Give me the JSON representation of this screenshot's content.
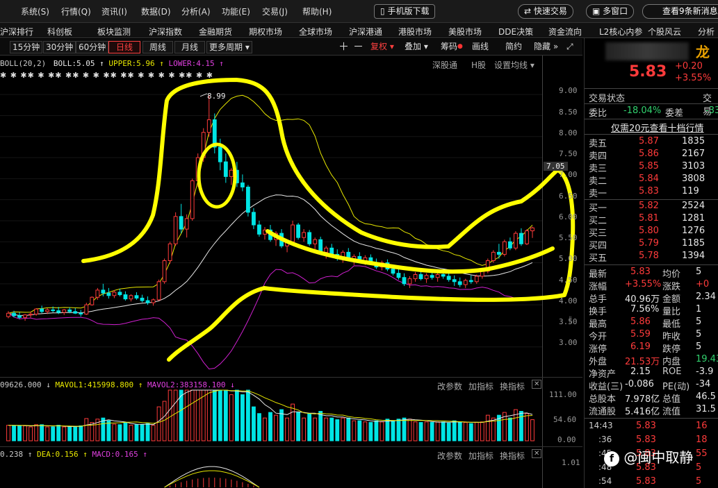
{
  "menu": {
    "items": [
      "系统(S)",
      "行情(Q)",
      "资讯(I)",
      "数据(D)",
      "分析(A)",
      "功能(E)",
      "交易(J)",
      "帮助(H)"
    ],
    "mobile_download": "手机版下载",
    "quick_trade": "快速交易",
    "multi_window": "多窗口",
    "notifications": "查看9条新消息"
  },
  "nav": {
    "items": [
      "沪深排行",
      "科创板",
      "板块监测",
      "沪深指数",
      "金融期货",
      "期权市场",
      "全球市场",
      "沪深港通",
      "港股市场",
      "美股市场",
      "DDE决策",
      "资金流向",
      "L2核心内参",
      "个股风云",
      "分析"
    ]
  },
  "period": {
    "items": [
      "15分钟",
      "30分钟",
      "60分钟",
      "日线",
      "周线",
      "月线",
      "更多周期"
    ],
    "active": "日线",
    "tools": [
      "复权",
      "叠加",
      "筹码",
      "画线",
      "简约",
      "隐藏"
    ]
  },
  "main_chart": {
    "boll_label": "BOLL(20,2)",
    "boll_value": "BOLL:5.05",
    "upper": "UPPER:5.96",
    "lower": "LOWER:4.15",
    "links": [
      "深股通",
      "H股",
      "设置均线"
    ],
    "peak_label": "8.99",
    "current_marker": "7.05",
    "y_ticks": [
      "9.00",
      "8.50",
      "8.00",
      "7.50",
      "7.00",
      "6.50",
      "6.00",
      "5.50",
      "5.00",
      "4.50",
      "4.00",
      "3.50",
      "3.00"
    ]
  },
  "vol_panel": {
    "vol": "09626.000",
    "mavol1": "MAVOL1:415998.800",
    "mavol2": "MAVOL2:383158.100",
    "buttons": [
      "改参数",
      "加指标",
      "换指标"
    ],
    "y_ticks": [
      "111.00",
      "54.60",
      "0.00"
    ]
  },
  "macd_panel": {
    "dif": "0.238",
    "dea": "DEA:0.156",
    "macd": "MACD:0.165",
    "buttons": [
      "改参数",
      "加指标",
      "换指标"
    ],
    "y_ticks": [
      "1.01"
    ]
  },
  "colors": {
    "up": "#ff3b3b",
    "down": "#00e5e5",
    "boll_mid": "#e8e8e8",
    "boll_upper": "#e8e800",
    "boll_lower": "#d020d0",
    "annotation": "#ffff00"
  },
  "chart_data": {
    "type": "candlestick",
    "ylim": [
      2.5,
      9.3
    ],
    "candles": [
      [
        3.72,
        3.85,
        3.68,
        3.8
      ],
      [
        3.8,
        3.86,
        3.7,
        3.74
      ],
      [
        3.74,
        3.82,
        3.66,
        3.7
      ],
      [
        3.7,
        3.78,
        3.62,
        3.76
      ],
      [
        3.76,
        3.84,
        3.7,
        3.78
      ],
      [
        3.78,
        3.92,
        3.74,
        3.9
      ],
      [
        3.9,
        3.98,
        3.8,
        3.84
      ],
      [
        3.84,
        3.92,
        3.78,
        3.88
      ],
      [
        3.88,
        3.96,
        3.82,
        3.86
      ],
      [
        3.86,
        3.95,
        3.78,
        3.82
      ],
      [
        3.82,
        3.9,
        3.76,
        3.88
      ],
      [
        3.88,
        3.94,
        3.8,
        3.84
      ],
      [
        3.84,
        3.92,
        3.78,
        3.8
      ],
      [
        3.8,
        3.88,
        3.72,
        3.78
      ],
      [
        3.78,
        4.05,
        3.76,
        4.0
      ],
      [
        4.0,
        4.2,
        3.98,
        4.18
      ],
      [
        4.18,
        4.4,
        4.12,
        4.35
      ],
      [
        4.35,
        4.5,
        4.2,
        4.28
      ],
      [
        4.28,
        4.4,
        4.15,
        4.22
      ],
      [
        4.22,
        4.35,
        4.16,
        4.3
      ],
      [
        4.3,
        4.38,
        4.2,
        4.24
      ],
      [
        4.24,
        4.32,
        4.1,
        4.14
      ],
      [
        4.14,
        4.25,
        4.08,
        4.22
      ],
      [
        4.22,
        4.3,
        4.12,
        4.16
      ],
      [
        4.16,
        4.24,
        4.06,
        4.1
      ],
      [
        4.1,
        4.2,
        4.0,
        4.05
      ],
      [
        4.05,
        4.15,
        3.98,
        4.12
      ],
      [
        4.12,
        4.6,
        4.1,
        4.55
      ],
      [
        4.55,
        5.1,
        4.5,
        5.05
      ],
      [
        5.05,
        5.5,
        4.98,
        5.45
      ],
      [
        5.45,
        6.2,
        5.4,
        6.1
      ],
      [
        6.1,
        6.4,
        5.7,
        5.8
      ],
      [
        5.8,
        6.15,
        5.6,
        6.05
      ],
      [
        6.05,
        7.0,
        6.0,
        6.95
      ],
      [
        6.95,
        7.6,
        6.8,
        7.5
      ],
      [
        7.5,
        8.2,
        7.4,
        8.1
      ],
      [
        8.1,
        8.99,
        8.0,
        8.4
      ],
      [
        8.4,
        8.55,
        7.6,
        7.75
      ],
      [
        7.75,
        7.95,
        7.2,
        7.4
      ],
      [
        7.4,
        7.6,
        6.9,
        7.05
      ],
      [
        7.05,
        7.25,
        6.85,
        7.2
      ],
      [
        7.2,
        7.4,
        6.8,
        6.9
      ],
      [
        6.9,
        7.1,
        6.7,
        6.8
      ],
      [
        6.8,
        6.85,
        6.1,
        6.2
      ],
      [
        6.2,
        6.3,
        5.8,
        5.9
      ],
      [
        5.9,
        6.0,
        5.62,
        5.68
      ],
      [
        5.68,
        5.85,
        5.55,
        5.78
      ],
      [
        5.78,
        5.9,
        5.5,
        5.55
      ],
      [
        5.55,
        5.75,
        5.4,
        5.7
      ],
      [
        5.7,
        5.8,
        5.35,
        5.4
      ],
      [
        5.4,
        5.55,
        5.25,
        5.5
      ],
      [
        5.5,
        6.0,
        5.45,
        5.9
      ],
      [
        5.9,
        5.95,
        5.55,
        5.6
      ],
      [
        5.6,
        5.8,
        5.5,
        5.72
      ],
      [
        5.72,
        5.78,
        5.4,
        5.45
      ],
      [
        5.45,
        5.6,
        5.3,
        5.55
      ],
      [
        5.55,
        5.62,
        5.2,
        5.25
      ],
      [
        5.25,
        5.4,
        5.1,
        5.35
      ],
      [
        5.35,
        5.45,
        5.15,
        5.2
      ],
      [
        5.2,
        5.32,
        5.05,
        5.1
      ],
      [
        5.1,
        5.3,
        5.0,
        5.25
      ],
      [
        5.25,
        5.35,
        5.05,
        5.08
      ],
      [
        5.08,
        5.2,
        4.95,
        5.15
      ],
      [
        5.15,
        5.25,
        5.0,
        5.05
      ],
      [
        5.05,
        5.18,
        4.95,
        5.12
      ],
      [
        5.12,
        5.2,
        4.98,
        5.0
      ],
      [
        5.0,
        5.1,
        4.85,
        4.9
      ],
      [
        4.9,
        5.05,
        4.82,
        5.0
      ],
      [
        5.0,
        5.08,
        4.8,
        4.85
      ],
      [
        4.85,
        4.95,
        4.7,
        4.75
      ],
      [
        4.75,
        4.88,
        4.6,
        4.65
      ],
      [
        4.65,
        4.75,
        4.45,
        4.5
      ],
      [
        4.5,
        4.68,
        4.4,
        4.62
      ],
      [
        4.62,
        4.78,
        4.55,
        4.72
      ],
      [
        4.72,
        4.8,
        4.58,
        4.62
      ],
      [
        4.62,
        4.75,
        4.52,
        4.7
      ],
      [
        4.7,
        4.82,
        4.6,
        4.65
      ],
      [
        4.65,
        4.78,
        4.55,
        4.72
      ],
      [
        4.72,
        4.85,
        4.62,
        4.68
      ],
      [
        4.68,
        4.76,
        4.55,
        4.6
      ],
      [
        4.6,
        4.7,
        4.45,
        4.55
      ],
      [
        4.55,
        4.65,
        4.42,
        4.48
      ],
      [
        4.48,
        4.62,
        4.4,
        4.58
      ],
      [
        4.58,
        4.7,
        4.5,
        4.55
      ],
      [
        4.55,
        4.72,
        4.5,
        4.68
      ],
      [
        4.68,
        4.85,
        4.62,
        4.8
      ],
      [
        4.8,
        5.1,
        4.75,
        5.05
      ],
      [
        5.05,
        5.3,
        5.0,
        5.25
      ],
      [
        5.25,
        5.45,
        5.1,
        5.2
      ],
      [
        5.2,
        5.55,
        5.15,
        5.5
      ],
      [
        5.5,
        5.6,
        5.3,
        5.35
      ],
      [
        5.35,
        5.75,
        5.3,
        5.7
      ],
      [
        5.7,
        5.82,
        5.4,
        5.45
      ],
      [
        5.45,
        5.8,
        5.42,
        5.76
      ],
      [
        5.76,
        5.86,
        5.59,
        5.83
      ]
    ]
  },
  "stock": {
    "name": "龙",
    "price": "5.83",
    "change": "+0.20",
    "change_pct": "+3.55%"
  },
  "quote": {
    "tab1": "交易状态",
    "tab2": "交易",
    "weibi_label": "委比",
    "weibi": "-18.04%",
    "weicha_label": "委差",
    "weicha": "-33",
    "level10": "仅需20元查看十档行情",
    "asks": [
      [
        "卖五",
        "5.87",
        "1835"
      ],
      [
        "卖四",
        "5.86",
        "2167"
      ],
      [
        "卖三",
        "5.85",
        "3103"
      ],
      [
        "卖二",
        "5.84",
        "3808"
      ],
      [
        "卖一",
        "5.83",
        "119"
      ]
    ],
    "bids": [
      [
        "买一",
        "5.82",
        "2524"
      ],
      [
        "买二",
        "5.81",
        "1281"
      ],
      [
        "买三",
        "5.80",
        "1276"
      ],
      [
        "买四",
        "5.79",
        "1185"
      ],
      [
        "买五",
        "5.78",
        "1394"
      ]
    ],
    "stats": [
      [
        "最新",
        "5.83",
        "均价",
        "5"
      ],
      [
        "涨幅",
        "+3.55%",
        "涨跌",
        "+0"
      ],
      [
        "总手",
        "40.96万",
        "金额",
        "2.34"
      ],
      [
        "换手",
        "7.56%",
        "量比",
        "1"
      ],
      [
        "最高",
        "5.86",
        "最低",
        "5"
      ],
      [
        "今开",
        "5.59",
        "昨收",
        "5"
      ],
      [
        "涨停",
        "6.19",
        "跌停",
        "5"
      ],
      [
        "外盘",
        "21.53万",
        "内盘",
        "19.43"
      ],
      [
        "净资产",
        "2.15",
        "ROE",
        "-3.9"
      ],
      [
        "收益(三)",
        "-0.086",
        "PE(动)",
        "-34"
      ],
      [
        "总股本",
        "7.978亿",
        "总值",
        "46.5"
      ],
      [
        "流通股",
        "5.416亿",
        "流值",
        "31.5"
      ]
    ],
    "ticks": [
      [
        "14:43",
        "5.83",
        "16"
      ],
      [
        ":36",
        "5.83",
        "18"
      ],
      [
        ":45",
        "5.83",
        "55"
      ],
      [
        ":48",
        "5.83",
        "5"
      ],
      [
        ":54",
        "5.83",
        "5"
      ]
    ]
  },
  "watermark": "@闽中取静"
}
